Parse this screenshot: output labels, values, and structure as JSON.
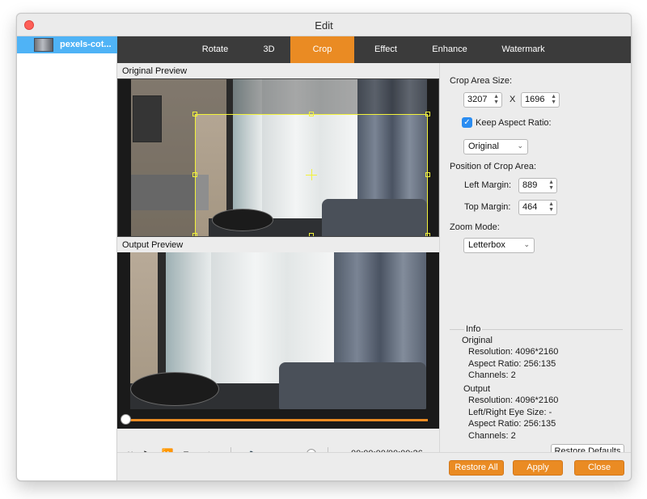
{
  "window": {
    "title": "Edit"
  },
  "sidebar": {
    "items": [
      {
        "label": "pexels-cot..."
      }
    ]
  },
  "tabs": [
    {
      "label": "Rotate"
    },
    {
      "label": "3D"
    },
    {
      "label": "Crop",
      "active": true
    },
    {
      "label": "Effect"
    },
    {
      "label": "Enhance"
    },
    {
      "label": "Watermark"
    }
  ],
  "preview": {
    "original_label": "Original Preview",
    "output_label": "Output Preview",
    "timecode": "00:00:00/00:00:26",
    "progress": 0,
    "volume": 1.0
  },
  "crop": {
    "area_size_label": "Crop Area Size:",
    "width": "3207",
    "x_label": "X",
    "height": "1696",
    "keep_aspect_label": "Keep Aspect Ratio:",
    "keep_aspect_checked": true,
    "aspect_value": "Original",
    "position_label": "Position of Crop Area:",
    "left_margin_label": "Left Margin:",
    "left_margin": "889",
    "top_margin_label": "Top Margin:",
    "top_margin": "464",
    "zoom_label": "Zoom Mode:",
    "zoom_value": "Letterbox"
  },
  "info": {
    "title": "Info",
    "original_heading": "Original",
    "original_resolution": "Resolution: 4096*2160",
    "original_aspect": "Aspect Ratio: 256:135",
    "original_channels": "Channels: 2",
    "output_heading": "Output",
    "output_resolution": "Resolution: 4096*2160",
    "output_eye": "Left/Right Eye Size: -",
    "output_aspect": "Aspect Ratio: 256:135",
    "output_channels": "Channels: 2"
  },
  "buttons": {
    "restore_defaults": "Restore Defaults",
    "restore_all": "Restore All",
    "apply": "Apply",
    "close": "Close"
  },
  "colors": {
    "accent": "#ea8b23",
    "tabbar": "#3b3b3b",
    "selection": "#4fb3f6",
    "crop_frame": "#f2f23a"
  }
}
